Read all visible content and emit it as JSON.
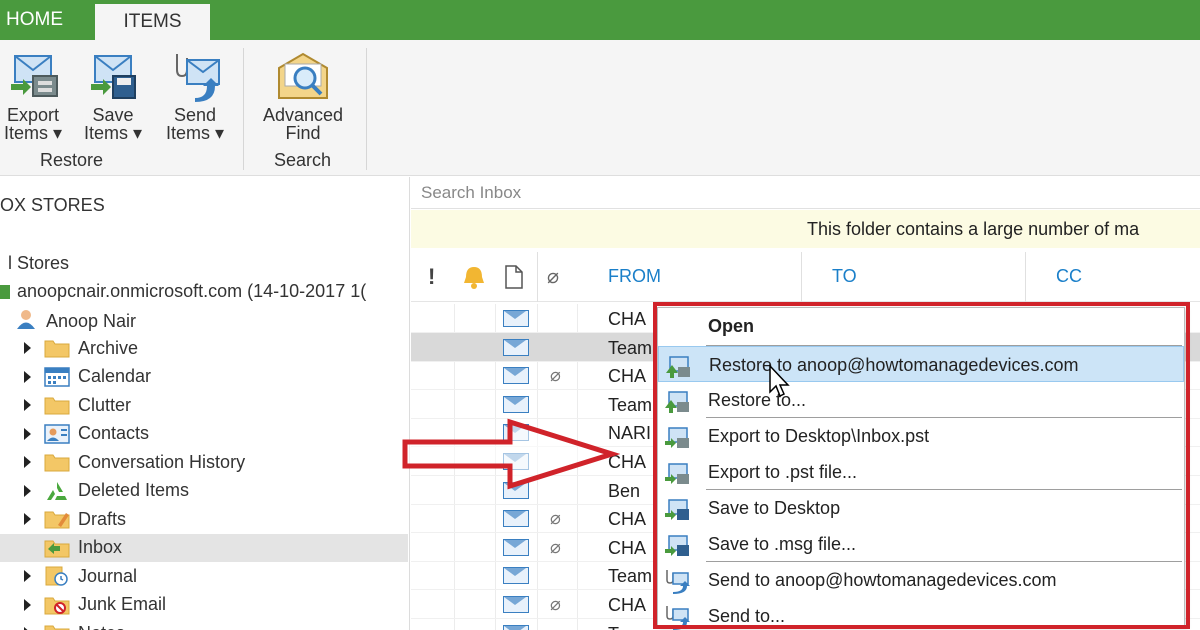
{
  "tabs": {
    "home": "HOME",
    "items": "ITEMS"
  },
  "ribbon": {
    "export_items": {
      "line1": "Export",
      "line2": "Items ▾"
    },
    "save_items": {
      "line1": "Save",
      "line2": "Items ▾"
    },
    "send_items": {
      "line1": "Send",
      "line2": "Items ▾"
    },
    "advanced_find": {
      "line1": "Advanced",
      "line2": "Find"
    },
    "group_restore": "Restore",
    "group_search": "Search"
  },
  "left_panel": {
    "title": "OX STORES",
    "stores": "l Stores",
    "account": "anoopcnair.onmicrosoft.com (14-10-2017 1(",
    "user": "Anoop Nair",
    "folders": [
      {
        "label": "Archive",
        "icon": "folder-icon"
      },
      {
        "label": "Calendar",
        "icon": "calendar-icon"
      },
      {
        "label": "Clutter",
        "icon": "folder-icon"
      },
      {
        "label": "Contacts",
        "icon": "contacts-icon"
      },
      {
        "label": "Conversation History",
        "icon": "folder-icon"
      },
      {
        "label": "Deleted Items",
        "icon": "recycle-icon"
      },
      {
        "label": "Drafts",
        "icon": "drafts-icon"
      },
      {
        "label": "Inbox",
        "icon": "inbox-icon",
        "selected": true
      },
      {
        "label": "Journal",
        "icon": "journal-icon"
      },
      {
        "label": "Junk Email",
        "icon": "junk-icon"
      },
      {
        "label": "Notes",
        "icon": "folder-icon"
      }
    ]
  },
  "search": {
    "placeholder": "Search Inbox"
  },
  "banner": "This folder contains a large number of ma",
  "columns": {
    "from": "FROM",
    "to": "TO",
    "cc": "CC"
  },
  "rows": [
    {
      "from": "CHA",
      "attachment": false
    },
    {
      "from": "Team",
      "attachment": false,
      "selected": true
    },
    {
      "from": "CHA",
      "attachment": true
    },
    {
      "from": "Team",
      "attachment": false
    },
    {
      "from": "NARI",
      "attachment": false
    },
    {
      "from": "CHA",
      "attachment": false
    },
    {
      "from": "Ben",
      "attachment": false
    },
    {
      "from": "CHA",
      "attachment": true
    },
    {
      "from": "CHA",
      "attachment": true
    },
    {
      "from": "Team",
      "attachment": false
    },
    {
      "from": "CHA",
      "attachment": true
    },
    {
      "from": "Team",
      "attachment": false
    }
  ],
  "context_menu": {
    "open": "Open",
    "restore_to_user": "Restore to anoop@howtomanagedevices.com",
    "restore_to": "Restore to...",
    "export_desktop": "Export to Desktop\\Inbox.pst",
    "export_pst": "Export to .pst file...",
    "save_desktop": "Save to Desktop",
    "save_msg": "Save to .msg file...",
    "send_to_user": "Send to anoop@howtomanagedevices.com",
    "send_to": "Send to..."
  },
  "colors": {
    "brand_green": "#4a9a3e",
    "highlight_red": "#d0232a",
    "link_blue": "#1a7fc9",
    "menu_highlight": "#cce4f7"
  }
}
